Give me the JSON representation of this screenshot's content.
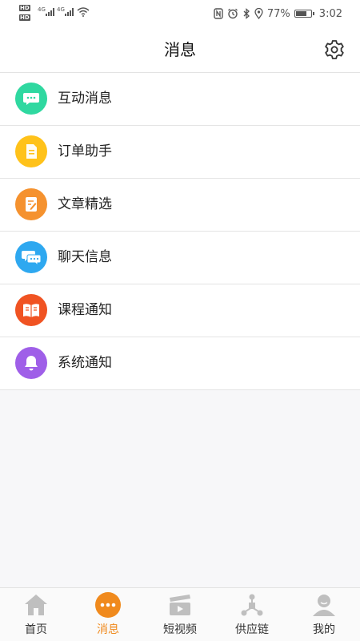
{
  "status_bar": {
    "hd1": "HD",
    "hd2": "HD",
    "net1": "4G",
    "net2": "4G",
    "battery_percent": "77%",
    "battery_level": 0.77,
    "time": "3:02"
  },
  "header": {
    "title": "消息"
  },
  "messages": [
    {
      "label": "互动消息",
      "icon": "chat-bubble-icon",
      "color": "#2fd8a0"
    },
    {
      "label": "订单助手",
      "icon": "document-icon",
      "color": "#ffc21a"
    },
    {
      "label": "文章精选",
      "icon": "article-edit-icon",
      "color": "#f5922f"
    },
    {
      "label": "聊天信息",
      "icon": "chat-messages-icon",
      "color": "#2ea8f0"
    },
    {
      "label": "课程通知",
      "icon": "open-book-icon",
      "color": "#f05322"
    },
    {
      "label": "系统通知",
      "icon": "bell-icon",
      "color": "#9f5fe8"
    }
  ],
  "tabs": [
    {
      "label": "首页",
      "icon": "home-icon"
    },
    {
      "label": "消息",
      "icon": "message-dots-icon",
      "active": true,
      "color": "#f08a1d"
    },
    {
      "label": "短视频",
      "icon": "video-clapper-icon"
    },
    {
      "label": "供应链",
      "icon": "supply-chain-icon"
    },
    {
      "label": "我的",
      "icon": "profile-icon"
    }
  ]
}
